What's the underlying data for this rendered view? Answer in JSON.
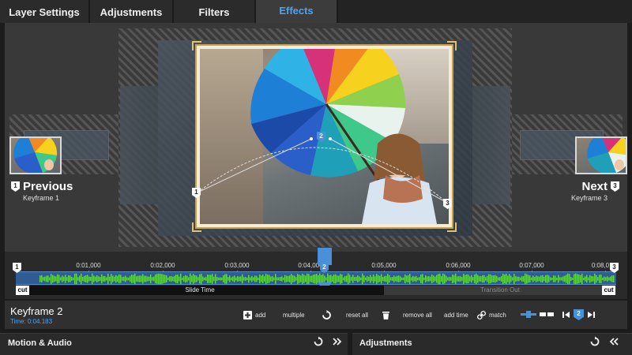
{
  "tabs": [
    {
      "label": "Layer Settings",
      "active": false
    },
    {
      "label": "Adjustments",
      "active": false
    },
    {
      "label": "Filters",
      "active": false
    },
    {
      "label": "Effects",
      "active": true
    }
  ],
  "stage": {
    "previous": {
      "label": "Previous",
      "sub": "Keyframe 1",
      "pin": "1"
    },
    "next": {
      "label": "Next",
      "sub": "Keyframe 3",
      "pin": "3"
    },
    "path_pins": [
      "1",
      "2",
      "3"
    ]
  },
  "timeline": {
    "ticks": [
      "0:01,000",
      "0:02,000",
      "0:03,000",
      "0:04,000",
      "0:05,000",
      "0:06,000",
      "0:07,000",
      "0:08,0"
    ],
    "slide_time_label": "Slide Time",
    "transition_out_label": "Transition Out",
    "cut_label": "cut",
    "pins": [
      "1",
      "2",
      "3"
    ]
  },
  "toolbar": {
    "keyframe_title": "Keyframe 2",
    "keyframe_time": "Time: 0:04.183",
    "add": "add",
    "multiple": "multiple",
    "reset_all": "reset all",
    "remove_all": "remove all",
    "add_time": "add time",
    "match": "match",
    "current_keyframe": "2"
  },
  "panels": {
    "left_title": "Motion & Audio",
    "right_title": "Adjustments"
  },
  "colors": {
    "accent": "#4ea3ee",
    "track": "#2f5c93",
    "wave": "#5fd64a",
    "frame": "#c9a24a"
  }
}
